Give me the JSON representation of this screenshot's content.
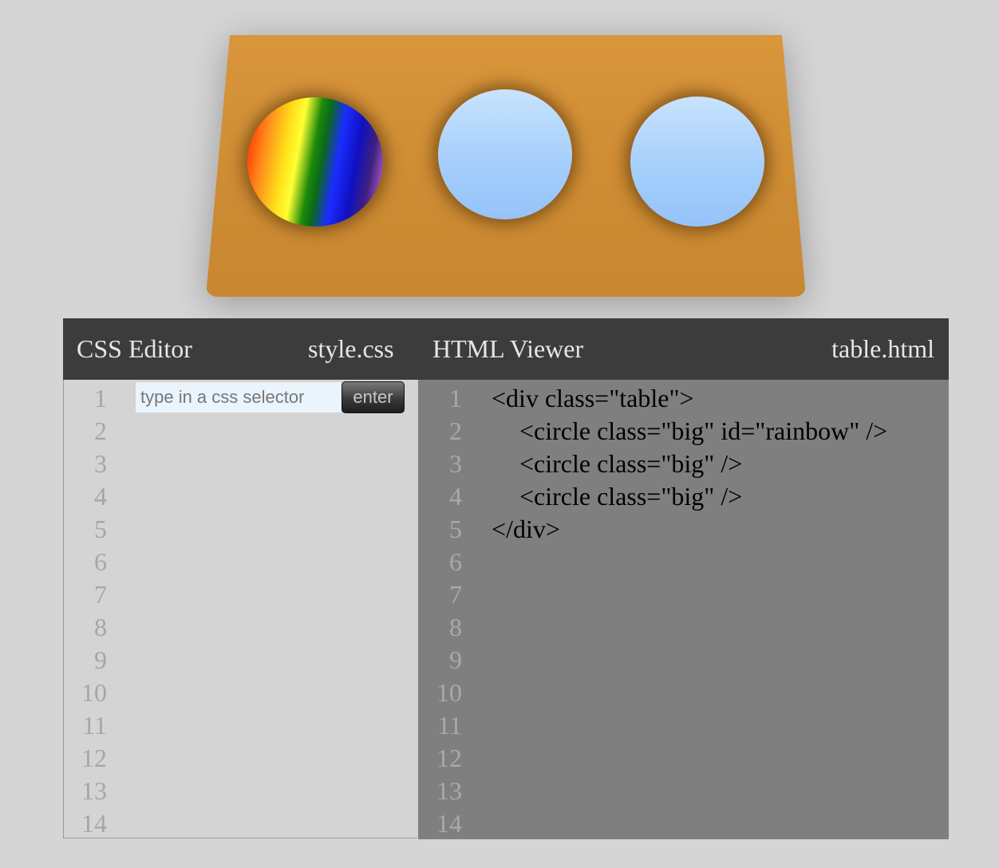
{
  "table": {
    "plates": [
      {
        "id": "rainbow",
        "class": "big",
        "fill": "rainbow"
      },
      {
        "class": "big",
        "fill": "blue"
      },
      {
        "class": "big",
        "fill": "blue"
      }
    ],
    "colors": {
      "table": "#d9963b",
      "plate": "#a3cdfb",
      "background": "#d5d5d5"
    }
  },
  "css_editor": {
    "title": "CSS Editor",
    "filename": "style.css",
    "input_placeholder": "type in a css selector",
    "input_value": "",
    "enter_label": "enter",
    "line_numbers": [
      "1",
      "2",
      "3",
      "4",
      "5",
      "6",
      "7",
      "8",
      "9",
      "10",
      "11",
      "12",
      "13",
      "14"
    ]
  },
  "html_viewer": {
    "title": "HTML Viewer",
    "filename": "table.html",
    "line_numbers": [
      "1",
      "2",
      "3",
      "4",
      "5",
      "6",
      "7",
      "8",
      "9",
      "10",
      "11",
      "12",
      "13",
      "14"
    ],
    "code_lines": [
      {
        "text": "<div class=\"table\">",
        "indent": false
      },
      {
        "text": "<circle class=\"big\" id=\"rainbow\" />",
        "indent": true
      },
      {
        "text": "<circle class=\"big\" />",
        "indent": true
      },
      {
        "text": "<circle class=\"big\" />",
        "indent": true
      },
      {
        "text": "</div>",
        "indent": false
      }
    ]
  }
}
